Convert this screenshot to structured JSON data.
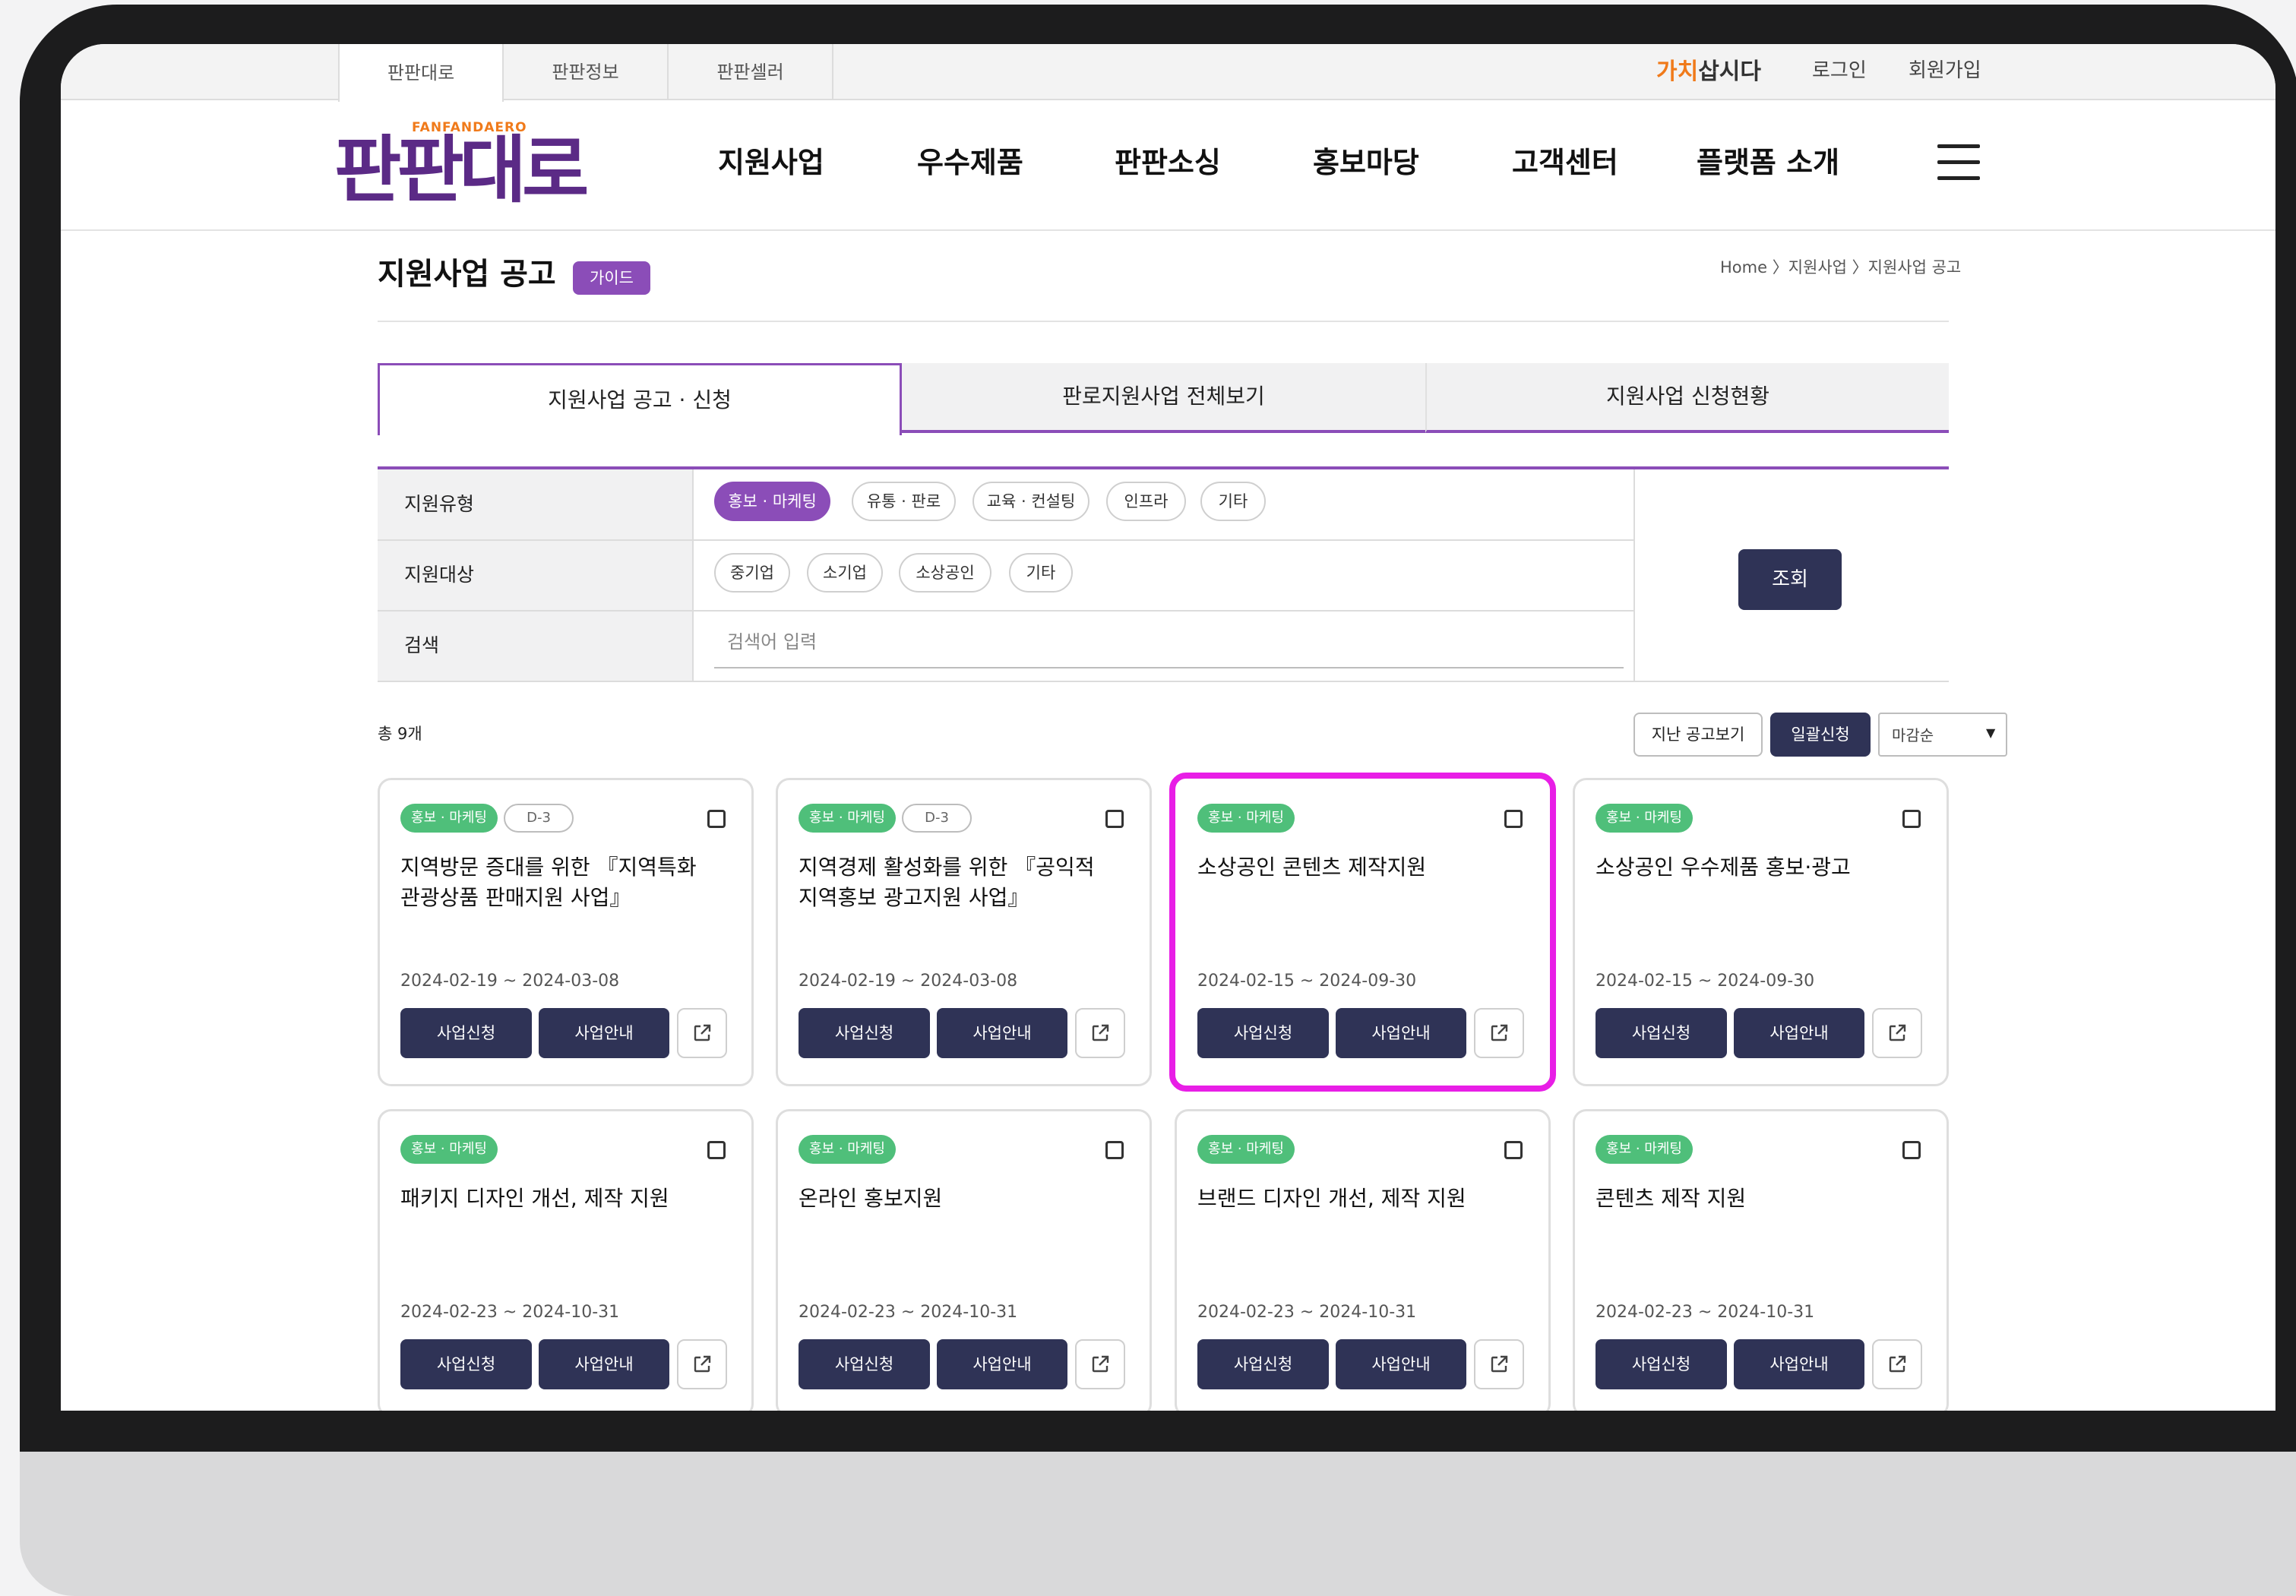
{
  "utility_bar": {
    "tabs": [
      "판판대로",
      "판판정보",
      "판판셀러"
    ],
    "brand_text_a": "가치",
    "brand_text_b": "삽시다",
    "login": "로그인",
    "signup": "회원가입"
  },
  "logo": {
    "tagline": "FANFANDAERO",
    "wordmark": "판판대로"
  },
  "nav": {
    "items": [
      "지원사업",
      "우수제품",
      "판판소싱",
      "홍보마당",
      "고객센터",
      "플랫폼 소개"
    ]
  },
  "page": {
    "title": "지원사업 공고",
    "guide_badge": "가이드",
    "breadcrumb": "Home 〉지원사업 〉지원사업 공고"
  },
  "tabs": [
    "지원사업 공고 · 신청",
    "판로지원사업 전체보기",
    "지원사업 신청현황"
  ],
  "filters": {
    "type_label": "지원유형",
    "type_options": [
      "홍보 · 마케팅",
      "유통 · 판로",
      "교육 · 컨설팅",
      "인프라",
      "기타"
    ],
    "target_label": "지원대상",
    "target_options": [
      "중기업",
      "소기업",
      "소상공인",
      "기타"
    ],
    "search_label": "검색",
    "search_placeholder": "검색어 입력",
    "search_button": "조회"
  },
  "list_bar": {
    "total": "총 9개",
    "past_button": "지난 공고보기",
    "bulk_button": "일괄신청",
    "sort_value": "마감순"
  },
  "cards": [
    {
      "category": "홍보 · 마케팅",
      "dday": "D-3",
      "title": "지역방문 증대를 위한 『지역특화 관광상품 판매지원 사업』",
      "dates": "2024-02-19 ~ 2024-03-08",
      "apply": "사업신청",
      "info": "사업안내"
    },
    {
      "category": "홍보 · 마케팅",
      "dday": "D-3",
      "title": "지역경제 활성화를 위한 『공익적 지역홍보 광고지원 사업』",
      "dates": "2024-02-19 ~ 2024-03-08",
      "apply": "사업신청",
      "info": "사업안내"
    },
    {
      "category": "홍보 · 마케팅",
      "dday": "",
      "title": "소상공인 콘텐츠 제작지원",
      "dates": "2024-02-15 ~ 2024-09-30",
      "apply": "사업신청",
      "info": "사업안내"
    },
    {
      "category": "홍보 · 마케팅",
      "dday": "",
      "title": "소상공인 우수제품 홍보·광고",
      "dates": "2024-02-15 ~ 2024-09-30",
      "apply": "사업신청",
      "info": "사업안내"
    },
    {
      "category": "홍보 · 마케팅",
      "dday": "",
      "title": "패키지 디자인 개선, 제작 지원",
      "dates": "2024-02-23 ~ 2024-10-31",
      "apply": "사업신청",
      "info": "사업안내"
    },
    {
      "category": "홍보 · 마케팅",
      "dday": "",
      "title": "온라인 홍보지원",
      "dates": "2024-02-23 ~ 2024-10-31",
      "apply": "사업신청",
      "info": "사업안내"
    },
    {
      "category": "홍보 · 마케팅",
      "dday": "",
      "title": "브랜드 디자인 개선, 제작 지원",
      "dates": "2024-02-23 ~ 2024-10-31",
      "apply": "사업신청",
      "info": "사업안내"
    },
    {
      "category": "홍보 · 마케팅",
      "dday": "",
      "title": "콘텐츠 제작 지원",
      "dates": "2024-02-23 ~ 2024-10-31",
      "apply": "사업신청",
      "info": "사업안내"
    }
  ],
  "colors": {
    "accent": "#8b4db8",
    "dark_button": "#2f3356",
    "category_green": "#4fbf7a",
    "highlight": "#e81ee6",
    "brand_orange": "#f07a1a"
  }
}
